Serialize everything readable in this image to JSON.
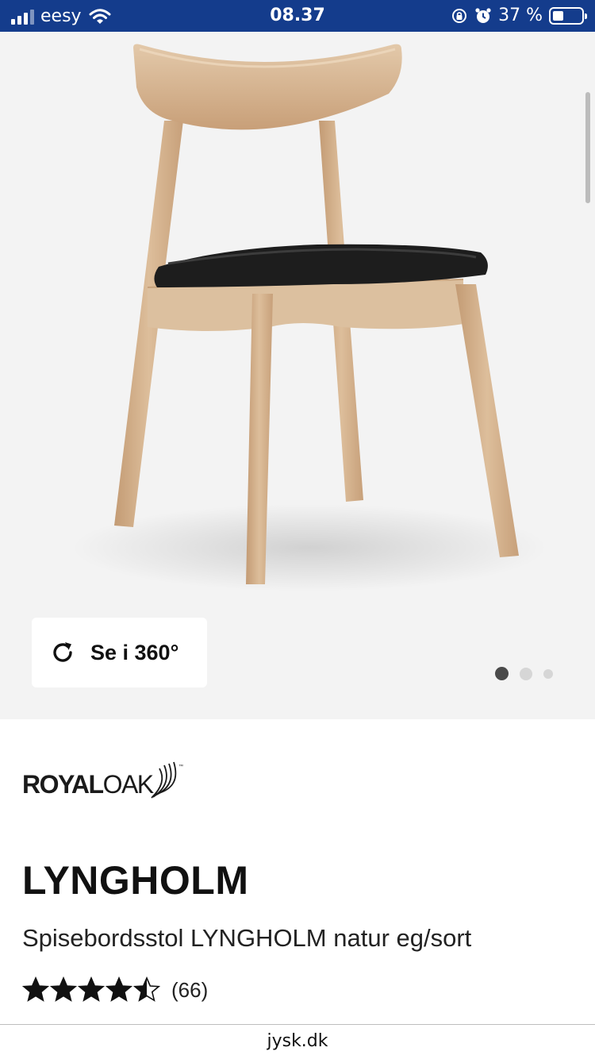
{
  "status_bar": {
    "carrier": "eesy",
    "time": "08.37",
    "battery_text": "37 %",
    "battery_level": 0.37
  },
  "hero": {
    "view_360_label": "Se i 360°",
    "carousel": {
      "total": 3,
      "active": 1
    }
  },
  "brand": {
    "name_bold": "ROYAL",
    "name_light": "OAK",
    "trademark": "™"
  },
  "product": {
    "title": "LYNGHOLM",
    "subtitle": "Spisebordsstol LYNGHOLM natur eg/sort",
    "rating": 4.5,
    "review_count": "(66)"
  },
  "browser": {
    "url": "jysk.dk"
  },
  "colors": {
    "status_bar_bg": "#143c8c",
    "hero_bg": "#f3f3f3",
    "dot_active": "#4a4a4a",
    "dot_inactive": "#d6d6d6"
  }
}
